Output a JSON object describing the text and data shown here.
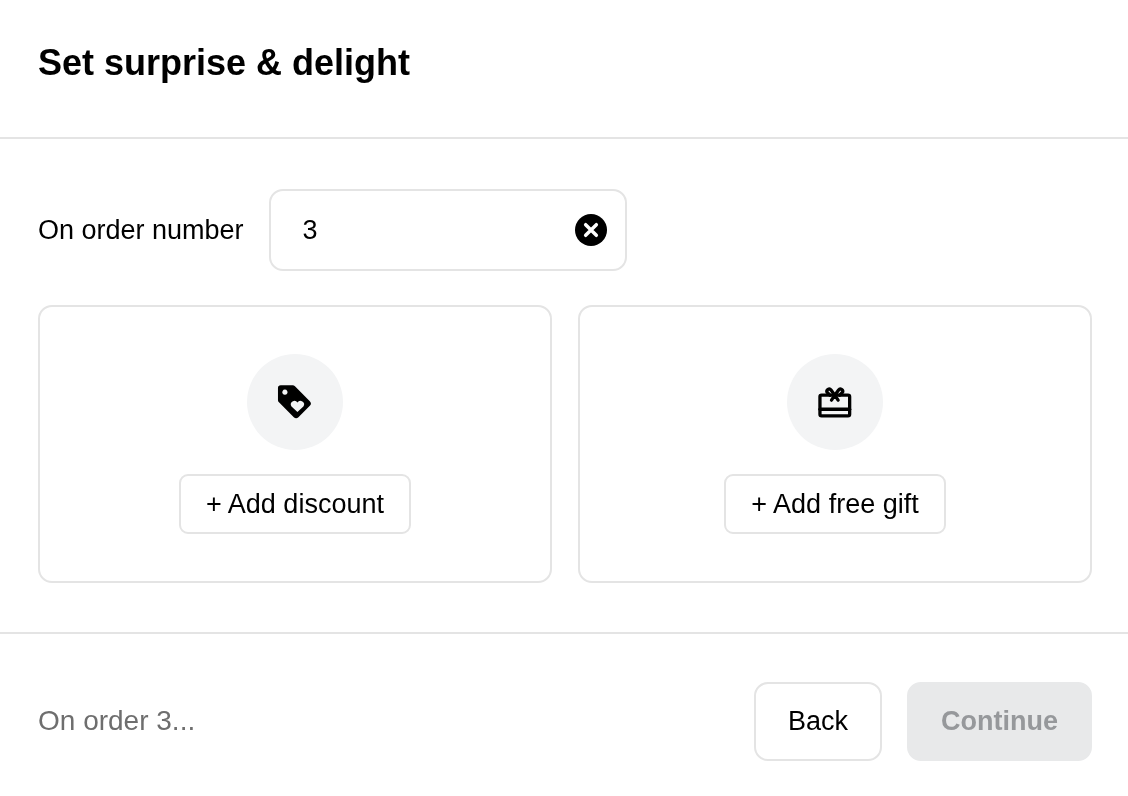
{
  "title": "Set surprise & delight",
  "order_field": {
    "label": "On order number",
    "value": "3"
  },
  "options": [
    {
      "kind": "discount",
      "button": "+ Add discount"
    },
    {
      "kind": "gift",
      "button": "+ Add free gift"
    }
  ],
  "footer": {
    "summary": "On order 3...",
    "buttons": [
      {
        "label": "Back",
        "disabled": false
      },
      {
        "label": "Continue",
        "disabled": true
      }
    ]
  }
}
